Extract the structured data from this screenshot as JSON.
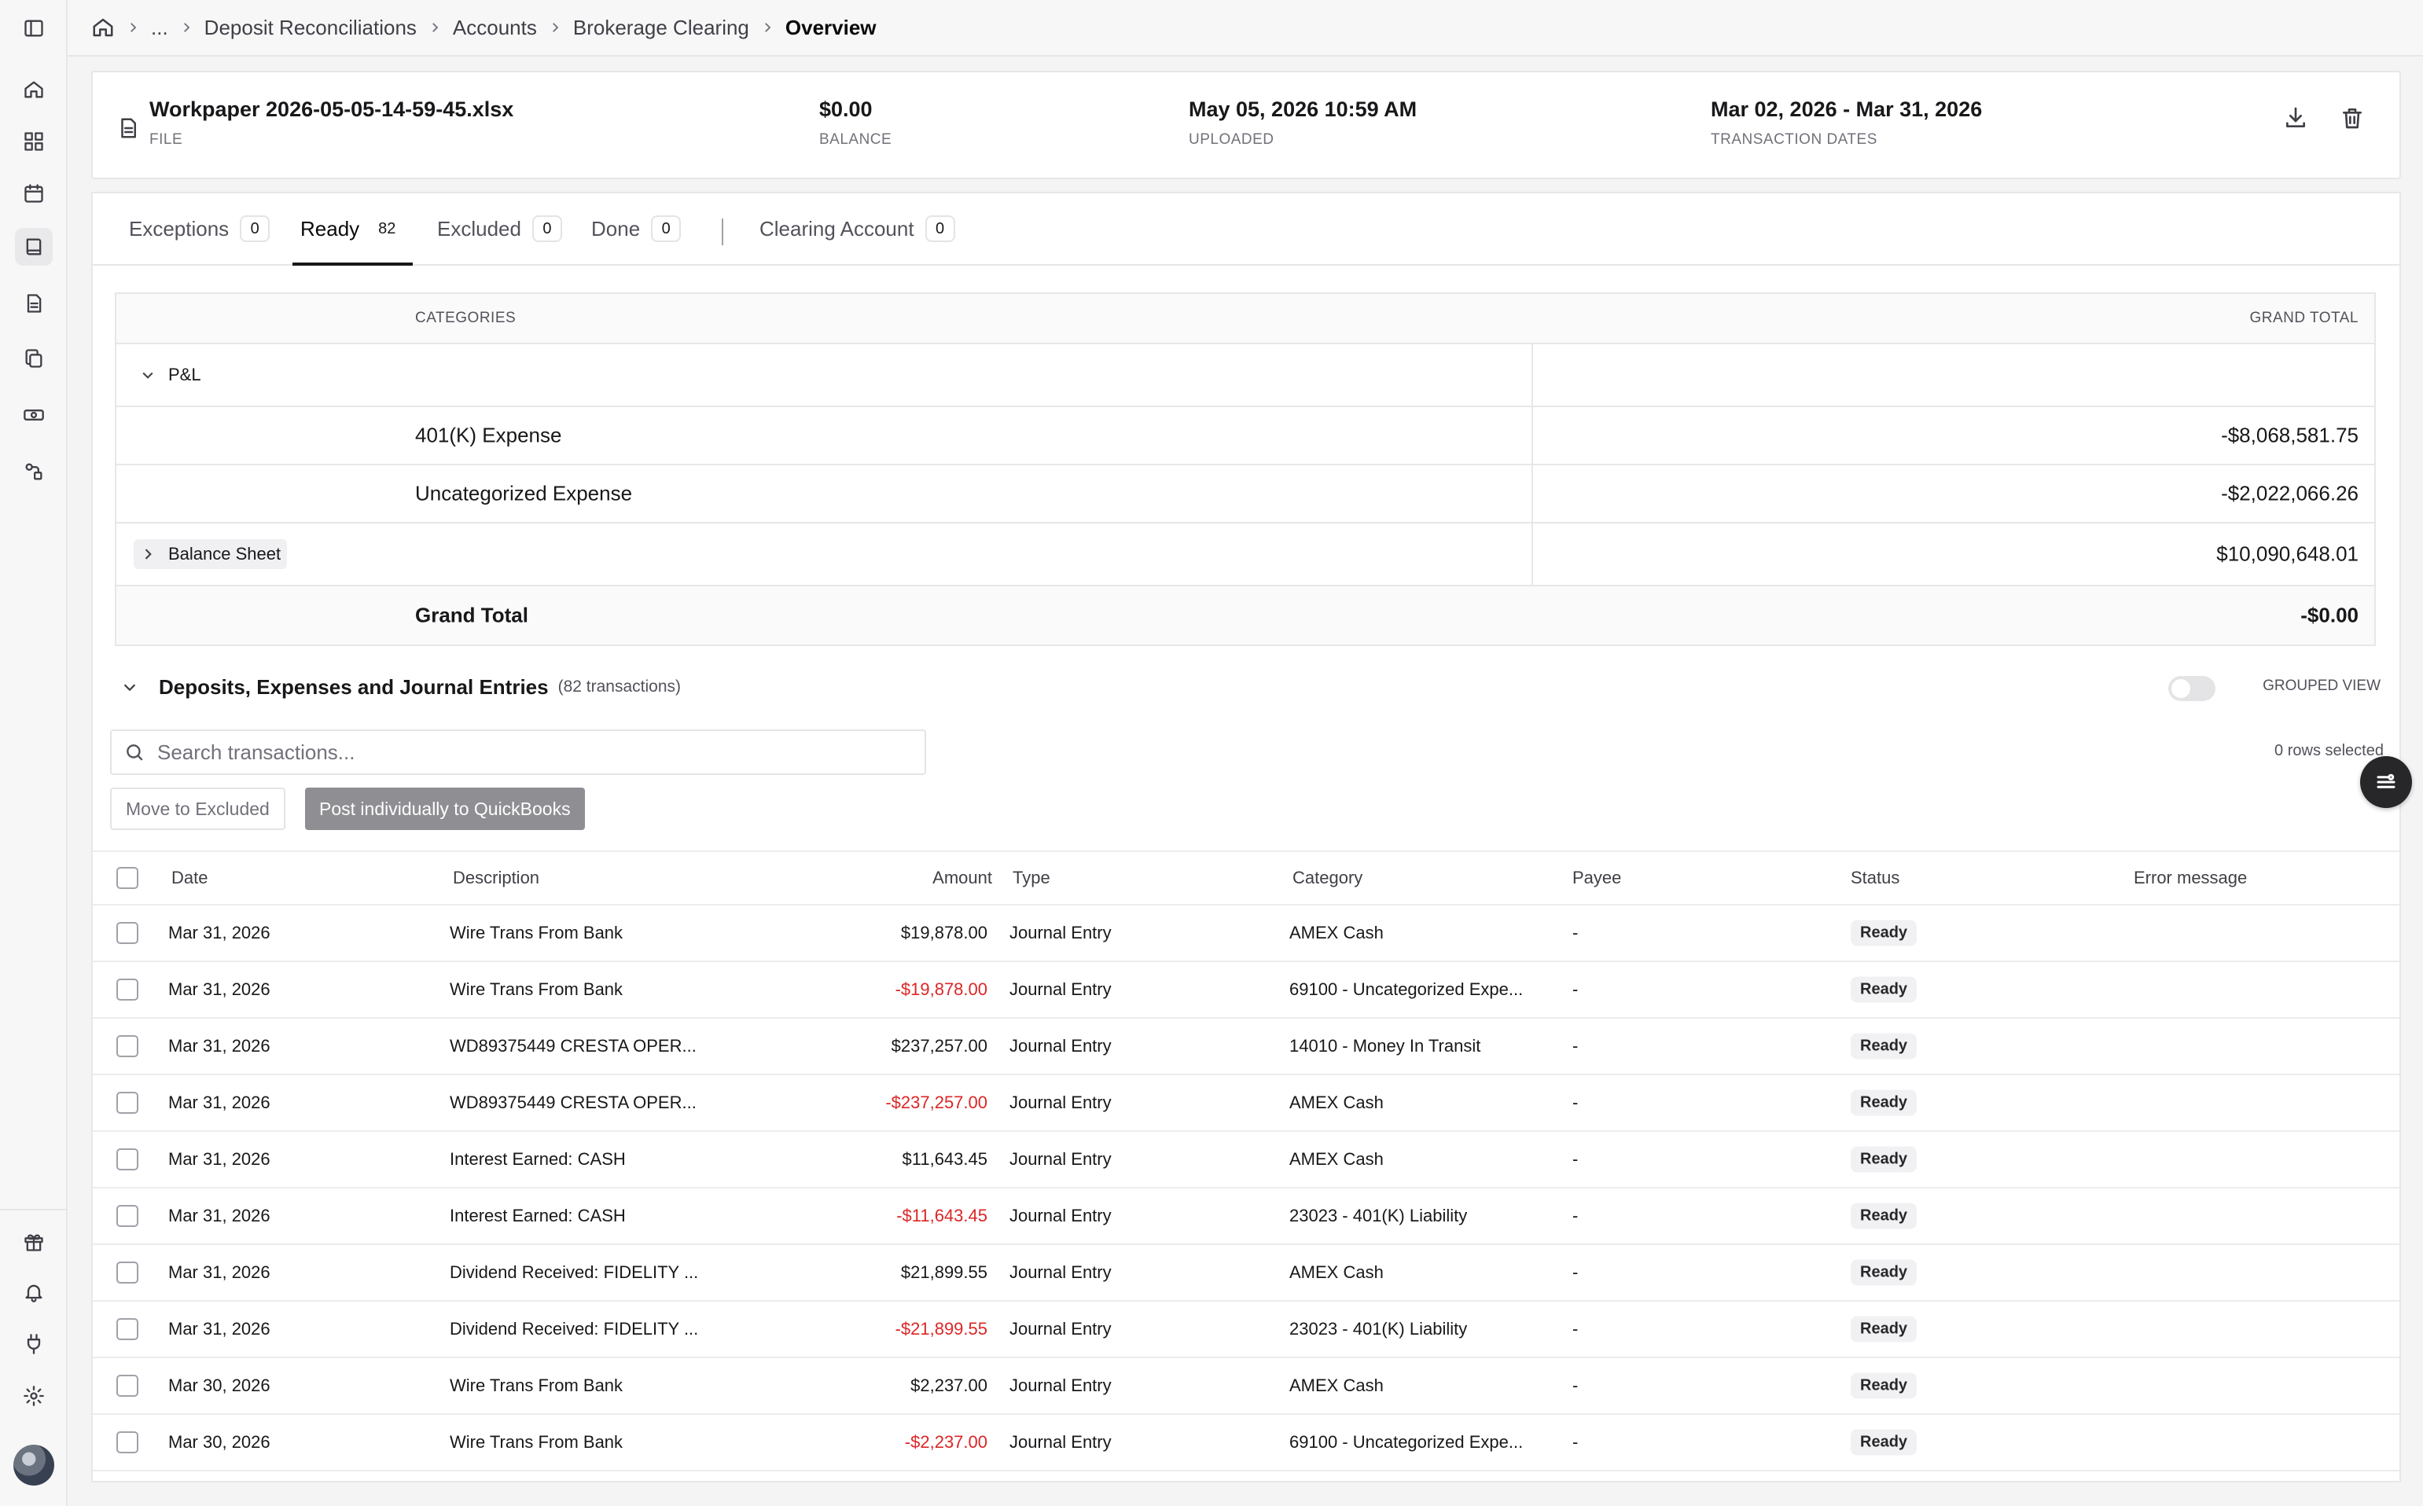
{
  "breadcrumb": {
    "ellipsis": "...",
    "items": [
      "Deposit Reconciliations",
      "Accounts",
      "Brokerage Clearing"
    ],
    "current": "Overview"
  },
  "file": {
    "name": "Workpaper 2026-05-05-14-59-45.xlsx",
    "name_label": "FILE",
    "balance": "$0.00",
    "balance_label": "BALANCE",
    "uploaded": "May 05, 2026 10:59 AM",
    "uploaded_label": "UPLOADED",
    "dates": "Mar 02, 2026 - Mar 31, 2026",
    "dates_label": "TRANSACTION DATES"
  },
  "tabs": [
    {
      "label": "Exceptions",
      "count": "0"
    },
    {
      "label": "Ready",
      "count": "82"
    },
    {
      "label": "Excluded",
      "count": "0"
    },
    {
      "label": "Done",
      "count": "0"
    },
    {
      "label": "Clearing Account",
      "count": "0"
    }
  ],
  "summary": {
    "col_categories": "CATEGORIES",
    "col_total": "GRAND TOTAL",
    "pl_label": "P&L",
    "rows": [
      {
        "name": "401(K) Expense",
        "total": "-$8,068,581.75"
      },
      {
        "name": "Uncategorized Expense",
        "total": "-$2,022,066.26"
      }
    ],
    "balance_sheet_label": "Balance Sheet",
    "balance_sheet_total": "$10,090,648.01",
    "grand_total_label": "Grand Total",
    "grand_total": "-$0.00"
  },
  "section": {
    "title": "Deposits, Expenses and Journal Entries",
    "subtitle": "(82 transactions)",
    "grouped_view_label": "GROUPED VIEW"
  },
  "search": {
    "placeholder": "Search transactions..."
  },
  "rows_selected": "0 rows selected",
  "buttons": {
    "move_excluded": "Move to Excluded",
    "post_qb": "Post individually to QuickBooks"
  },
  "table": {
    "headers": {
      "date": "Date",
      "description": "Description",
      "amount": "Amount",
      "type": "Type",
      "category": "Category",
      "payee": "Payee",
      "status": "Status",
      "error": "Error message"
    },
    "rows": [
      {
        "date": "Mar 31, 2026",
        "description": "Wire Trans From Bank",
        "amount": "$19,878.00",
        "type": "Journal Entry",
        "category": "AMEX Cash",
        "payee": "-",
        "status": "Ready"
      },
      {
        "date": "Mar 31, 2026",
        "description": "Wire Trans From Bank",
        "amount": "-$19,878.00",
        "type": "Journal Entry",
        "category": "69100 - Uncategorized Expe...",
        "payee": "-",
        "status": "Ready"
      },
      {
        "date": "Mar 31, 2026",
        "description": "WD89375449 CRESTA OPER...",
        "amount": "$237,257.00",
        "type": "Journal Entry",
        "category": "14010 - Money In Transit",
        "payee": "-",
        "status": "Ready"
      },
      {
        "date": "Mar 31, 2026",
        "description": "WD89375449 CRESTA OPER...",
        "amount": "-$237,257.00",
        "type": "Journal Entry",
        "category": "AMEX Cash",
        "payee": "-",
        "status": "Ready"
      },
      {
        "date": "Mar 31, 2026",
        "description": "Interest Earned: CASH",
        "amount": "$11,643.45",
        "type": "Journal Entry",
        "category": "AMEX Cash",
        "payee": "-",
        "status": "Ready"
      },
      {
        "date": "Mar 31, 2026",
        "description": "Interest Earned: CASH",
        "amount": "-$11,643.45",
        "type": "Journal Entry",
        "category": "23023 - 401(K) Liability",
        "payee": "-",
        "status": "Ready"
      },
      {
        "date": "Mar 31, 2026",
        "description": "Dividend Received: FIDELITY ...",
        "amount": "$21,899.55",
        "type": "Journal Entry",
        "category": "AMEX Cash",
        "payee": "-",
        "status": "Ready"
      },
      {
        "date": "Mar 31, 2026",
        "description": "Dividend Received: FIDELITY ...",
        "amount": "-$21,899.55",
        "type": "Journal Entry",
        "category": "23023 - 401(K) Liability",
        "payee": "-",
        "status": "Ready"
      },
      {
        "date": "Mar 30, 2026",
        "description": "Wire Trans From Bank",
        "amount": "$2,237.00",
        "type": "Journal Entry",
        "category": "AMEX Cash",
        "payee": "-",
        "status": "Ready"
      },
      {
        "date": "Mar 30, 2026",
        "description": "Wire Trans From Bank",
        "amount": "-$2,237.00",
        "type": "Journal Entry",
        "category": "69100 - Uncategorized Expe...",
        "payee": "-",
        "status": "Ready"
      }
    ]
  }
}
